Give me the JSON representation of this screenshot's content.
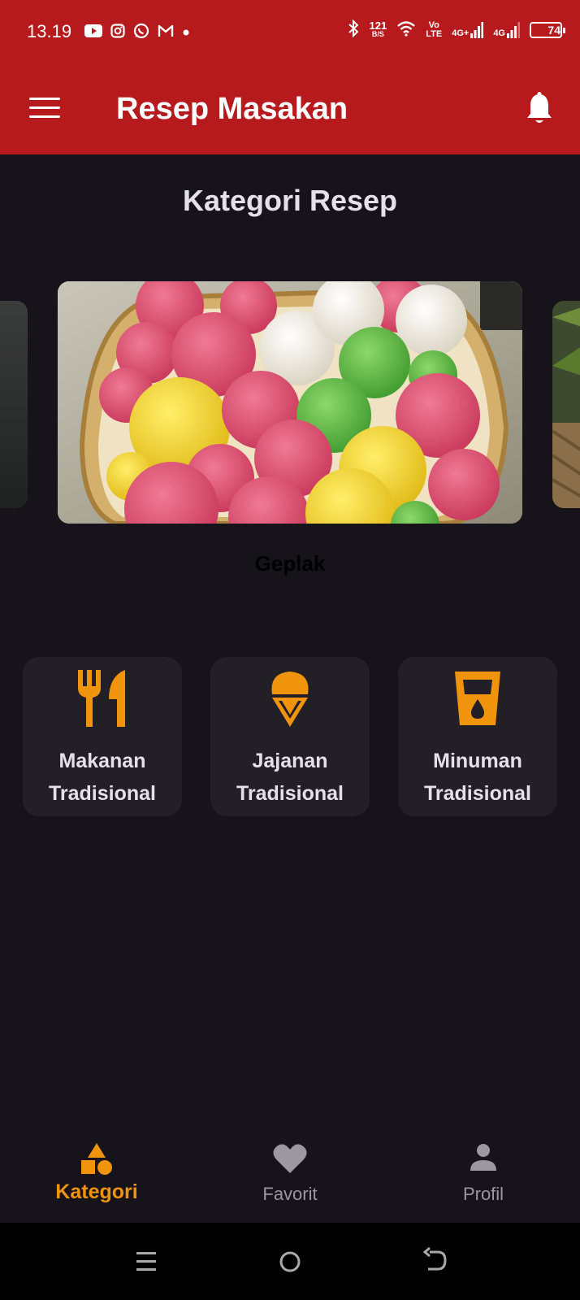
{
  "status_bar": {
    "time": "13.19",
    "net_speed_value": "121",
    "net_speed_unit": "B/S",
    "volte_top": "Vo",
    "volte_bottom": "LTE",
    "net1": "4G+",
    "net2": "4G",
    "battery": "74",
    "icons": [
      "youtube-icon",
      "instagram-icon",
      "whatsapp-icon",
      "gmail-icon",
      "dot-icon",
      "bluetooth-icon",
      "wifi-icon",
      "signal-icon"
    ]
  },
  "app_bar": {
    "title": "Resep Masakan",
    "icons": [
      "menu-icon",
      "bell-icon"
    ]
  },
  "main": {
    "section_title": "Kategori Resep",
    "carousel": {
      "current_caption": "Geplak"
    },
    "categories": [
      {
        "line1": "Makanan",
        "line2": "Tradisional",
        "icon": "fork-knife-icon"
      },
      {
        "line1": "Jajanan",
        "line2": "Tradisional",
        "icon": "ice-cream-icon"
      },
      {
        "line1": "Minuman",
        "line2": "Tradisional",
        "icon": "drink-cup-icon"
      }
    ]
  },
  "bottom_nav": {
    "items": [
      {
        "label": "Kategori",
        "icon": "category-shapes-icon",
        "active": true
      },
      {
        "label": "Favorit",
        "icon": "heart-icon",
        "active": false
      },
      {
        "label": "Profil",
        "icon": "person-icon",
        "active": false
      }
    ]
  },
  "colors": {
    "header": "#b61a1c",
    "background": "#16131a",
    "card": "#231f26",
    "accent": "#f0940e",
    "nav_inactive": "#9c97a0"
  }
}
